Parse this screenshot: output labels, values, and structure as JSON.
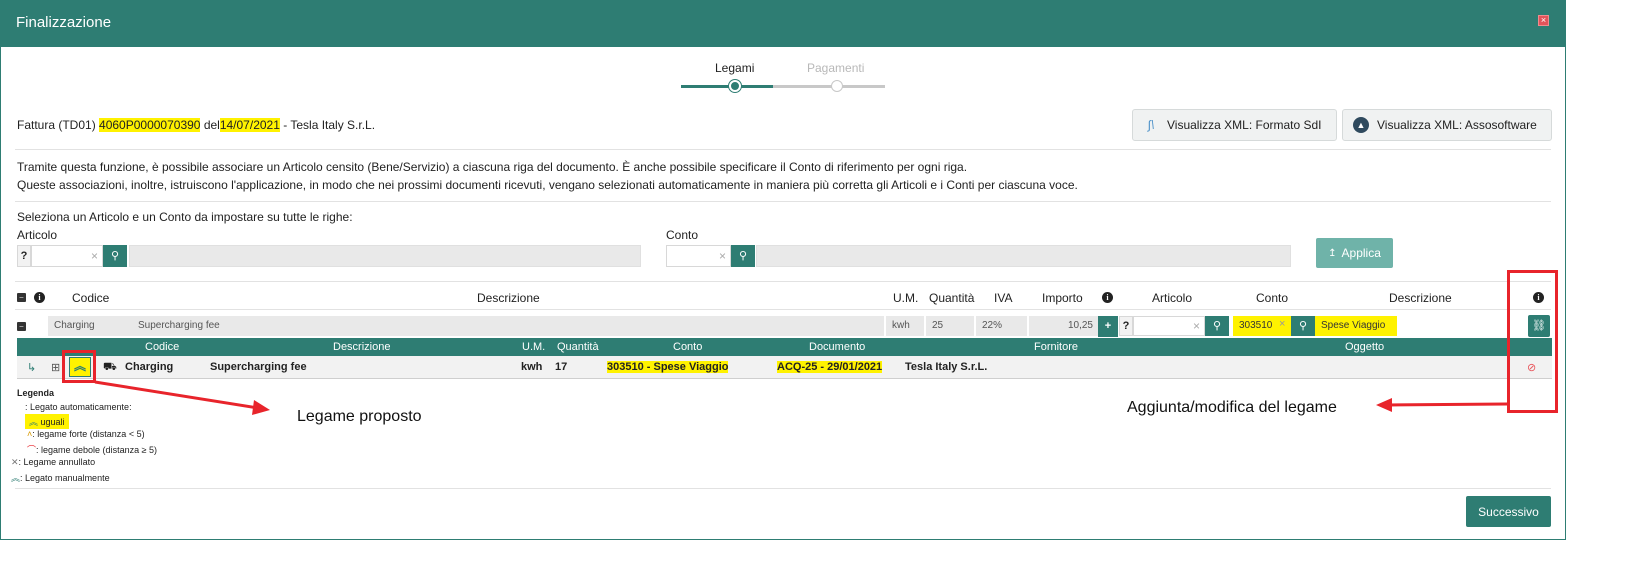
{
  "window": {
    "title": "Finalizzazione"
  },
  "stepper": {
    "steps": [
      "Legami",
      "Pagamenti"
    ]
  },
  "invoice": {
    "prefix": "Fattura (TD01)",
    "number": "4060P0000070390",
    "del": "del",
    "date": "14/07/2021",
    "supplier": "- Tesla Italy S.r.L."
  },
  "buttons": {
    "xml_sdi": "Visualizza XML: Formato SdI",
    "xml_asso": "Visualizza XML: Assosoftware",
    "applica": "Applica",
    "successivo": "Successivo"
  },
  "info": {
    "line1": "Tramite questa funzione, è possibile associare un Articolo censito (Bene/Servizio) a ciascuna riga del documento. È anche possibile specificare il Conto di riferimento per ogni riga.",
    "line2": "Queste associazioni, inoltre, istruiscono l'applicazione, in modo che nei prossimi documenti ricevuti, vengano selezionati automaticamente in maniera più corretta gli Articoli e i Conti per ciascuna voce."
  },
  "bulk": {
    "heading": "Seleziona un Articolo e un Conto da impostare su tutte le righe:",
    "articolo_label": "Articolo",
    "conto_label": "Conto",
    "q": "?"
  },
  "table": {
    "headers": {
      "codice": "Codice",
      "descrizione": "Descrizione",
      "um": "U.M.",
      "quantita": "Quantità",
      "iva": "IVA",
      "importo": "Importo",
      "articolo": "Articolo",
      "conto": "Conto",
      "descrizione2": "Descrizione"
    },
    "row": {
      "codice": "Charging",
      "descrizione": "Supercharging fee",
      "um": "kwh",
      "quantita": "25",
      "iva": "22%",
      "importo": "10,25",
      "q": "?",
      "conto": "303510",
      "conto_desc": "Spese Viaggio"
    },
    "sub_headers": {
      "codice": "Codice",
      "descrizione": "Descrizione",
      "um": "U.M.",
      "quantita": "Quantità",
      "conto": "Conto",
      "documento": "Documento",
      "fornitore": "Fornitore",
      "oggetto": "Oggetto"
    },
    "sub_row": {
      "codice": "Charging",
      "descrizione": "Supercharging fee",
      "um": "kwh",
      "quantita": "17",
      "conto": "303510 - Spese Viaggio",
      "documento": "ACQ-25 - 29/01/2021",
      "fornitore": "Tesla Italy S.r.L."
    }
  },
  "legend": {
    "title": "Legenda",
    "auto": ": Legato automaticamente:",
    "uguali": "uguali",
    "forte": ": legame forte (distanza < 5)",
    "debole": ": legame debole (distanza ≥ 5)",
    "annullato": ": Legame annullato",
    "manuale": ": Legato manualmente"
  },
  "annotations": {
    "proposto": "Legame proposto",
    "aggiunta": "Aggiunta/modifica del legame"
  },
  "colors": {
    "accent": "#2e7d73",
    "highlight": "#fff200",
    "annotation": "#e8242b"
  },
  "icons": [
    "close-icon",
    "sdi-icon",
    "assosoftware-icon",
    "search-icon",
    "plus-icon",
    "link-icon",
    "unlink-icon",
    "info-icon",
    "collapse-icon",
    "expand-icon",
    "cart-icon",
    "return-arrow-icon",
    "chevrons-up-icon"
  ]
}
